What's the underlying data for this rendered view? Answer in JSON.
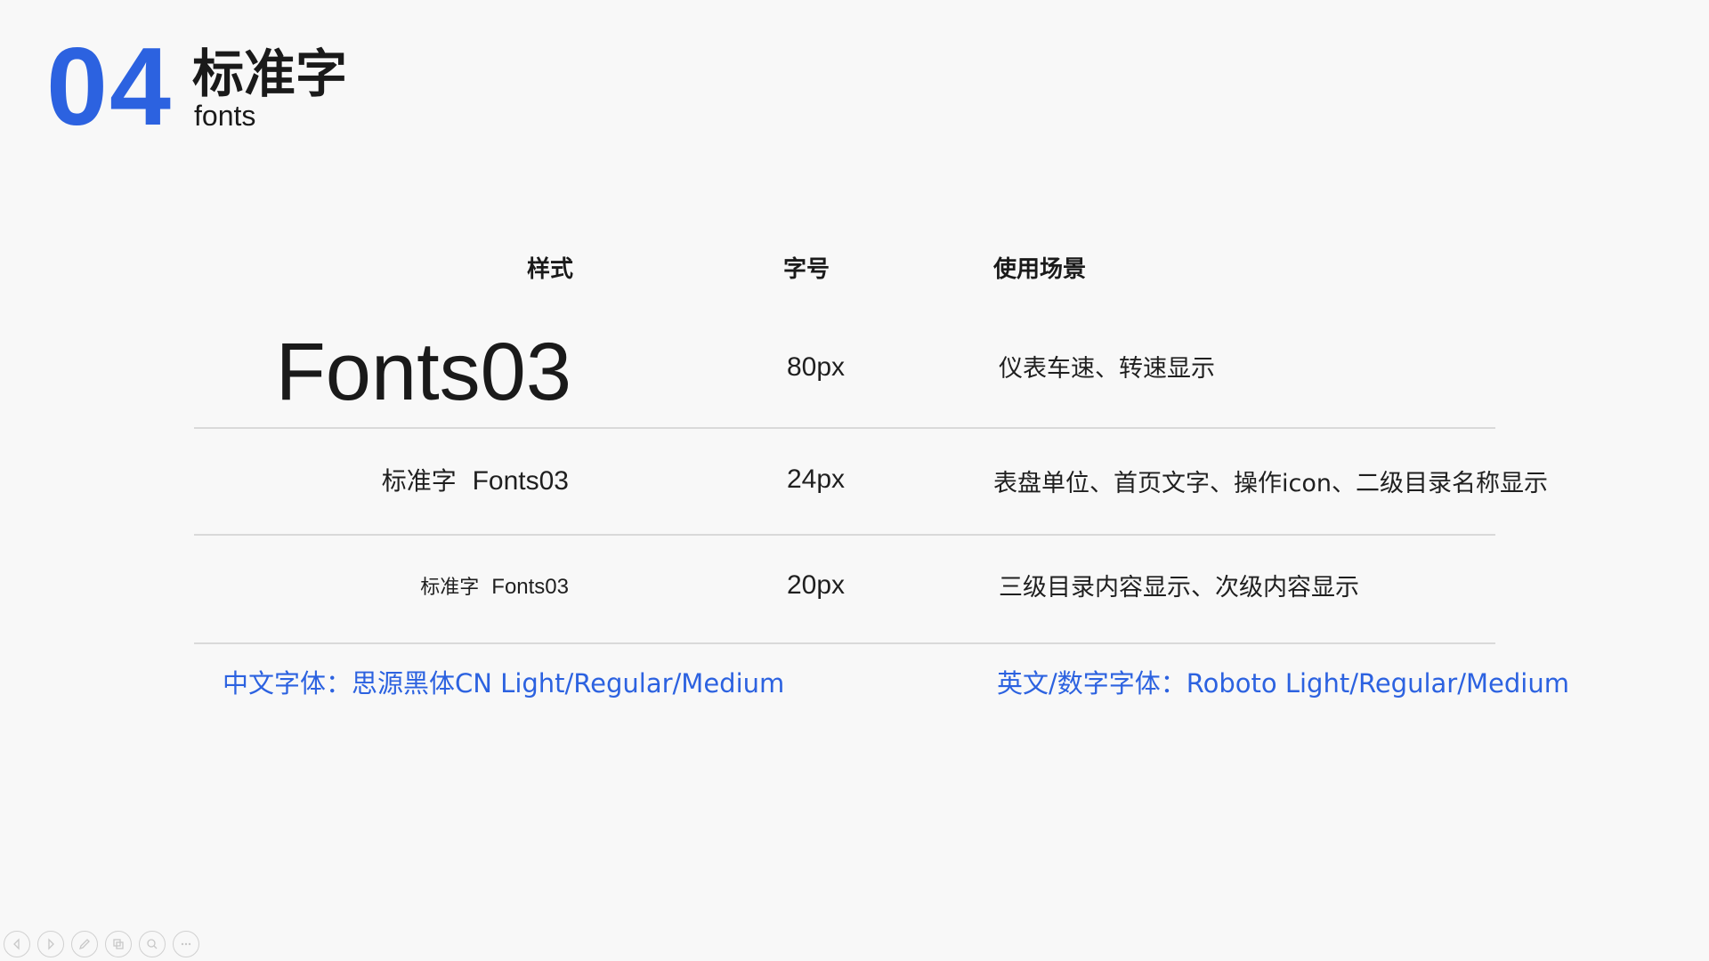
{
  "header": {
    "number": "04",
    "title": "标准字",
    "subtitle": "fonts"
  },
  "table": {
    "columns": {
      "style": "样式",
      "size": "字号",
      "usage": "使用场景"
    },
    "rows": [
      {
        "sample_cn": "",
        "sample_latin": "Fonts03",
        "size": "80px",
        "usage": "仪表车速、转速显示"
      },
      {
        "sample_cn": "标准字",
        "sample_latin": "Fonts03",
        "size": "24px",
        "usage": "表盘单位、首页文字、操作icon、二级目录名称显示"
      },
      {
        "sample_cn": "标准字",
        "sample_latin": "Fonts03",
        "size": "20px",
        "usage": "三级目录内容显示、次级内容显示"
      }
    ]
  },
  "notes": {
    "chinese_font": "中文字体：思源黑体CN  Light/Regular/Medium",
    "english_font": "英文/数字字体：Roboto Light/Regular/Medium"
  },
  "toolbar": {
    "icons": [
      "previous-icon",
      "next-icon",
      "pen-icon",
      "slides-icon",
      "zoom-icon",
      "more-icon"
    ]
  },
  "colors": {
    "accent": "#2c62e0",
    "background": "#f8f8f8",
    "divider": "#d9d9d9"
  }
}
